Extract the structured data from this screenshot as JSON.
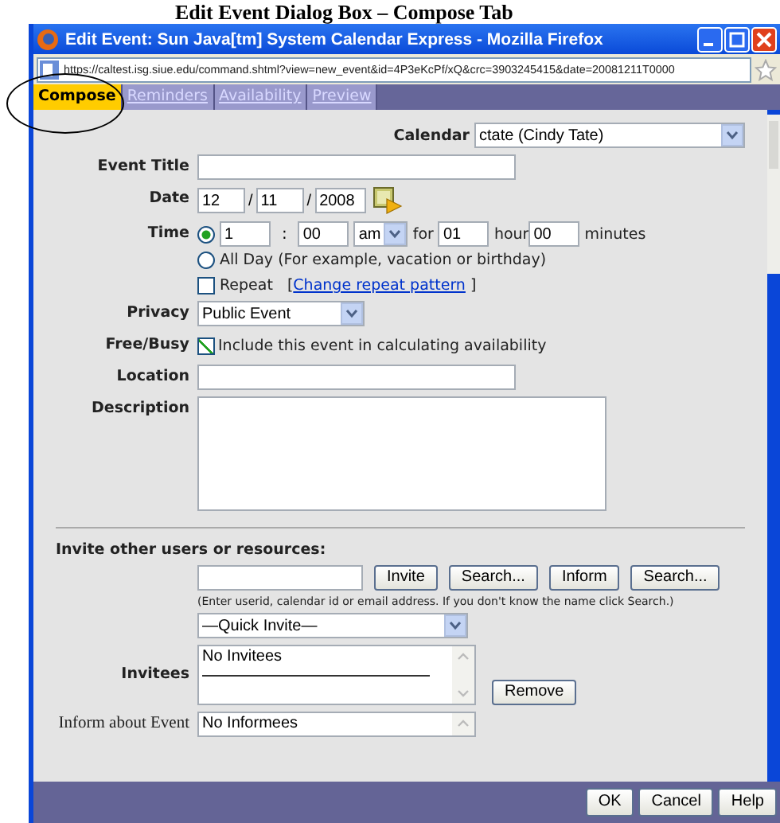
{
  "heading": "Edit Event Dialog Box – Compose Tab",
  "window": {
    "title": "Edit Event: Sun Java[tm] System Calendar Express - Mozilla Firefox"
  },
  "address_bar": {
    "value": "https://caltest.isg.siue.edu/command.shtml?view=new_event&id=4P3eKcPf/xQ&crc=3903245415&date=20081211T0000"
  },
  "tabs": [
    {
      "label": "Compose",
      "selected": true
    },
    {
      "label": "Reminders",
      "selected": false
    },
    {
      "label": "Availability",
      "selected": false
    },
    {
      "label": "Preview",
      "selected": false
    }
  ],
  "form": {
    "calendar": {
      "label": "Calendar",
      "value": "ctate (Cindy Tate)"
    },
    "event_title": {
      "label": "Event Title"
    },
    "date": {
      "label": "Date",
      "month": "12",
      "day": "11",
      "year": "2008",
      "separator": "/"
    },
    "time": {
      "label": "Time",
      "options": [
        {
          "kind": "timed",
          "selected": true,
          "hour": "1",
          "colon": ":",
          "minute": "00",
          "ampm": "am",
          "for_label": "for",
          "duration_hours": "01",
          "hour_label": "hour",
          "duration_minutes": "00",
          "minutes_label": "minutes"
        },
        {
          "kind": "allday",
          "selected": false,
          "label": "All Day (For example, vacation or birthday)"
        }
      ]
    },
    "repeat": {
      "label": "Repeat",
      "checked": false,
      "bracket_open": "[",
      "link": "Change repeat pattern",
      "bracket_close": "]"
    },
    "privacy": {
      "label": "Privacy",
      "value": "Public Event"
    },
    "free_busy": {
      "label": "Free/Busy",
      "option": "Include this event in calculating availability",
      "checked": true
    },
    "location": {
      "label": "Location"
    },
    "description": {
      "label": "Description"
    }
  },
  "invite": {
    "heading": "Invite other users or resources:",
    "buttons": [
      "Invite",
      "Search...",
      "Inform",
      "Search..."
    ],
    "hint": "(Enter userid, calendar id or email address. If you don't know the name click Search.)",
    "quick_invite": "—Quick Invite—",
    "invitees": {
      "label": "Invitees",
      "items": [
        "No Invitees"
      ]
    },
    "remove_button": "Remove",
    "inform": {
      "label": "Inform about Event",
      "items": [
        "No Informees"
      ]
    }
  },
  "footer_buttons": [
    "OK",
    "Cancel",
    "Help"
  ]
}
